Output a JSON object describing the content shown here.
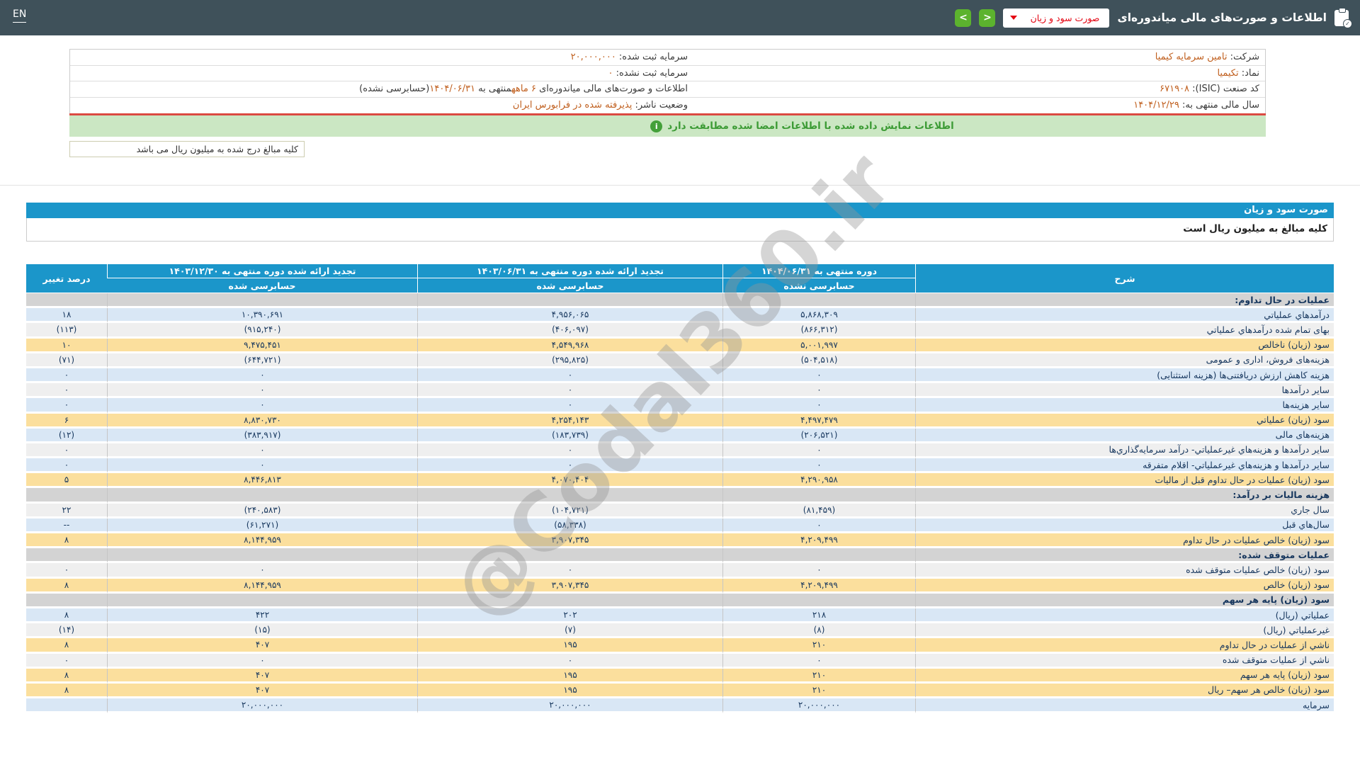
{
  "navbar": {
    "en_label": "EN",
    "title": "اطلاعات و صورت‌های مالی میاندوره‌ای",
    "title_icon": "clipboard-check-icon",
    "dropdown_value": "صورت سود و زیان",
    "prev_button": "<",
    "next_button": ">"
  },
  "company_info": {
    "rows": [
      {
        "first": [
          {
            "t": "شرکت: "
          },
          {
            "t": "تامین سرمایه کیمیا",
            "o": true
          }
        ],
        "second": [
          {
            "t": "سرمایه ثبت شده: "
          },
          {
            "t": "۲۰,۰۰۰,۰۰۰",
            "o": true
          }
        ]
      },
      {
        "first": [
          {
            "t": "نماد: "
          },
          {
            "t": "تکیمیا",
            "o": true
          }
        ],
        "second": [
          {
            "t": "سرمایه ثبت نشده: "
          },
          {
            "t": "۰",
            "o": true
          }
        ]
      },
      {
        "first": [
          {
            "t": "کد صنعت (ISIC): "
          },
          {
            "t": "۶۷۱۹۰۸",
            "o": true
          }
        ],
        "second": [
          {
            "t": "اطلاعات و صورت‌های مالی میاندوره‌ای "
          },
          {
            "t": "۶ ماهه",
            "o": true
          },
          {
            "t": "منتهی به "
          },
          {
            "t": "۱۴۰۴/۰۶/۳۱",
            "o": true
          },
          {
            "t": "(حسابرسی نشده)"
          }
        ]
      },
      {
        "first": [
          {
            "t": "سال مالی منتهی به: "
          },
          {
            "t": "۱۴۰۴/۱۲/۲۹",
            "o": true
          }
        ],
        "second": [
          {
            "t": "وضعیت ناشر: "
          },
          {
            "t": "پذیرفته شده در فرابورس ایران",
            "o": true
          }
        ]
      }
    ]
  },
  "banner": {
    "text": "اطلاعات نمایش داده شده با اطلاعات امضا شده مطابقت دارد",
    "icon": "info-icon"
  },
  "note_box": {
    "text": "کلیه مبالغ درج شده به میلیون ریال می باشد"
  },
  "statement": {
    "title": "صورت سود و زیان",
    "units_note": "کلیه مبالغ به میلیون ریال است"
  },
  "table": {
    "headers": {
      "desc": "شرح",
      "pct": "درصد تغییر",
      "col_current": {
        "period": "دوره منتهی به ۱۴۰۴/۰۶/۳۱",
        "audit": "حسابرسی نشده"
      },
      "col_restated_mid": {
        "period": "تجدید ارائه شده دوره منتهی به ۱۴۰۳/۰۶/۳۱",
        "audit": "حسابرسی شده"
      },
      "col_restated_annual": {
        "period": "تجدید ارائه شده دوره منتهی به ۱۴۰۳/۱۲/۳۰",
        "audit": "حسابرسی شده"
      }
    },
    "rows": [
      {
        "label": "عملیات در حال تداوم:",
        "style": "section"
      },
      {
        "label": "درآمدهاي عملياتي",
        "style": "blue",
        "values": [
          "۵,۸۶۸,۳۰۹",
          "۴,۹۵۶,۰۶۵",
          "۱۰,۳۹۰,۶۹۱"
        ],
        "pct": "۱۸"
      },
      {
        "label": "بهای تمام شده درآمدهاي عملياتي",
        "style": "gray",
        "values": [
          "(۸۶۶,۳۱۲)",
          "(۴۰۶,۰۹۷)",
          "(۹۱۵,۲۴۰)"
        ],
        "pct": "(۱۱۳)"
      },
      {
        "label": "سود (زیان) ناخالص",
        "style": "yellow",
        "values": [
          "۵,۰۰۱,۹۹۷",
          "۴,۵۴۹,۹۶۸",
          "۹,۴۷۵,۴۵۱"
        ],
        "pct": "۱۰"
      },
      {
        "label": "هزینه‌های فروش، اداری و عمومی",
        "style": "gray",
        "values": [
          "(۵۰۴,۵۱۸)",
          "(۲۹۵,۸۲۵)",
          "(۶۴۴,۷۲۱)"
        ],
        "pct": "(۷۱)"
      },
      {
        "label": "هزینه کاهش ارزش دریافتنی‌ها (هزینه استثنایی)",
        "style": "blue",
        "values": [
          "۰",
          "۰",
          "۰"
        ],
        "pct": "۰"
      },
      {
        "label": "سایر درآمدها",
        "style": "gray",
        "values": [
          "۰",
          "۰",
          "۰"
        ],
        "pct": "۰"
      },
      {
        "label": "سایر هزینه‌ها",
        "style": "blue",
        "values": [
          "۰",
          "۰",
          "۰"
        ],
        "pct": "۰"
      },
      {
        "label": "سود (زیان) عملیاتي",
        "style": "yellow",
        "values": [
          "۴,۴۹۷,۴۷۹",
          "۴,۲۵۴,۱۴۳",
          "۸,۸۳۰,۷۳۰"
        ],
        "pct": "۶"
      },
      {
        "label": "هزینه‌های مالی",
        "style": "blue",
        "values": [
          "(۲۰۶,۵۲۱)",
          "(۱۸۳,۷۳۹)",
          "(۳۸۳,۹۱۷)"
        ],
        "pct": "(۱۲)"
      },
      {
        "label": "سایر درآمدها و هزینه‌هاي غیرعملیاتي- درآمد سرمایه‌گذاري‌ها",
        "style": "gray",
        "values": [
          "۰",
          "۰",
          "۰"
        ],
        "pct": "۰"
      },
      {
        "label": "سایر درآمدها و هزینه‌هاي غیرعملیاتي- اقلام متفرقه",
        "style": "blue",
        "values": [
          "۰",
          "۰",
          "۰"
        ],
        "pct": "۰"
      },
      {
        "label": "سود (زیان) عملیات در حال تداوم قبل از مالیات",
        "style": "yellow",
        "values": [
          "۴,۲۹۰,۹۵۸",
          "۴,۰۷۰,۴۰۴",
          "۸,۴۴۶,۸۱۳"
        ],
        "pct": "۵"
      },
      {
        "label": "هزینه مالیات بر درآمد:",
        "style": "section"
      },
      {
        "label": "سال جاري",
        "style": "gray",
        "values": [
          "(۸۱,۴۵۹)",
          "(۱۰۴,۷۲۱)",
          "(۲۴۰,۵۸۳)"
        ],
        "pct": "۲۲"
      },
      {
        "label": "سال‌هاي قبل",
        "style": "blue",
        "values": [
          "۰",
          "(۵۸,۳۳۸)",
          "(۶۱,۲۷۱)"
        ],
        "pct": "--"
      },
      {
        "label": "سود (زیان) خالص عملیات در حال تداوم",
        "style": "yellow",
        "values": [
          "۴,۲۰۹,۴۹۹",
          "۳,۹۰۷,۳۴۵",
          "۸,۱۴۴,۹۵۹"
        ],
        "pct": "۸"
      },
      {
        "label": "عملیات متوقف شده:",
        "style": "section"
      },
      {
        "label": "سود (زیان) خالص عملیات متوقف شده",
        "style": "gray",
        "values": [
          "۰",
          "۰",
          "۰"
        ],
        "pct": "۰"
      },
      {
        "label": "سود (زیان) خالص",
        "style": "yellow",
        "values": [
          "۴,۲۰۹,۴۹۹",
          "۳,۹۰۷,۳۴۵",
          "۸,۱۴۴,۹۵۹"
        ],
        "pct": "۸"
      },
      {
        "label": "سود (زیان) پایه هر سهم",
        "style": "section"
      },
      {
        "label": "عملیاتي (ریال)",
        "style": "blue",
        "values": [
          "۲۱۸",
          "۲۰۲",
          "۴۲۲"
        ],
        "pct": "۸"
      },
      {
        "label": "غیرعملیاتي (ریال)",
        "style": "gray",
        "values": [
          "(۸)",
          "(۷)",
          "(۱۵)"
        ],
        "pct": "(۱۴)"
      },
      {
        "label": "ناشي از عملیات در حال تداوم",
        "style": "yellow",
        "values": [
          "۲۱۰",
          "۱۹۵",
          "۴۰۷"
        ],
        "pct": "۸"
      },
      {
        "label": "ناشي از عملیات متوقف شده",
        "style": "gray",
        "values": [
          "۰",
          "۰",
          "۰"
        ],
        "pct": "۰"
      },
      {
        "label": "سود (زیان) پایه هر سهم",
        "style": "yellow",
        "values": [
          "۲۱۰",
          "۱۹۵",
          "۴۰۷"
        ],
        "pct": "۸"
      },
      {
        "label": "سود (زیان) خالص هر سهم– ریال",
        "style": "yellow",
        "values": [
          "۲۱۰",
          "۱۹۵",
          "۴۰۷"
        ],
        "pct": "۸"
      },
      {
        "label": "سرمایه",
        "style": "blue",
        "values": [
          "۲۰,۰۰۰,۰۰۰",
          "۲۰,۰۰۰,۰۰۰",
          "۲۰,۰۰۰,۰۰۰"
        ],
        "pct": ""
      }
    ]
  },
  "watermark": {
    "text": "@Codal360.ir"
  },
  "colors": {
    "navbar": "#3f515a",
    "header_blue": "#1b96ca",
    "row_blue": "#d9e7f5",
    "row_gray": "#efefef",
    "row_yellow": "#fbdf9d",
    "row_section": "#d3d3d3",
    "value_navy": "#17375e",
    "negative_red": "#e01515",
    "info_orange": "#c05f1e",
    "banner_green_bg": "#cbe7c3",
    "banner_green_text": "#3c9b35",
    "red_line": "#db4a42",
    "button_green": "#5cb32e",
    "dropdown_red": "#e40613"
  }
}
